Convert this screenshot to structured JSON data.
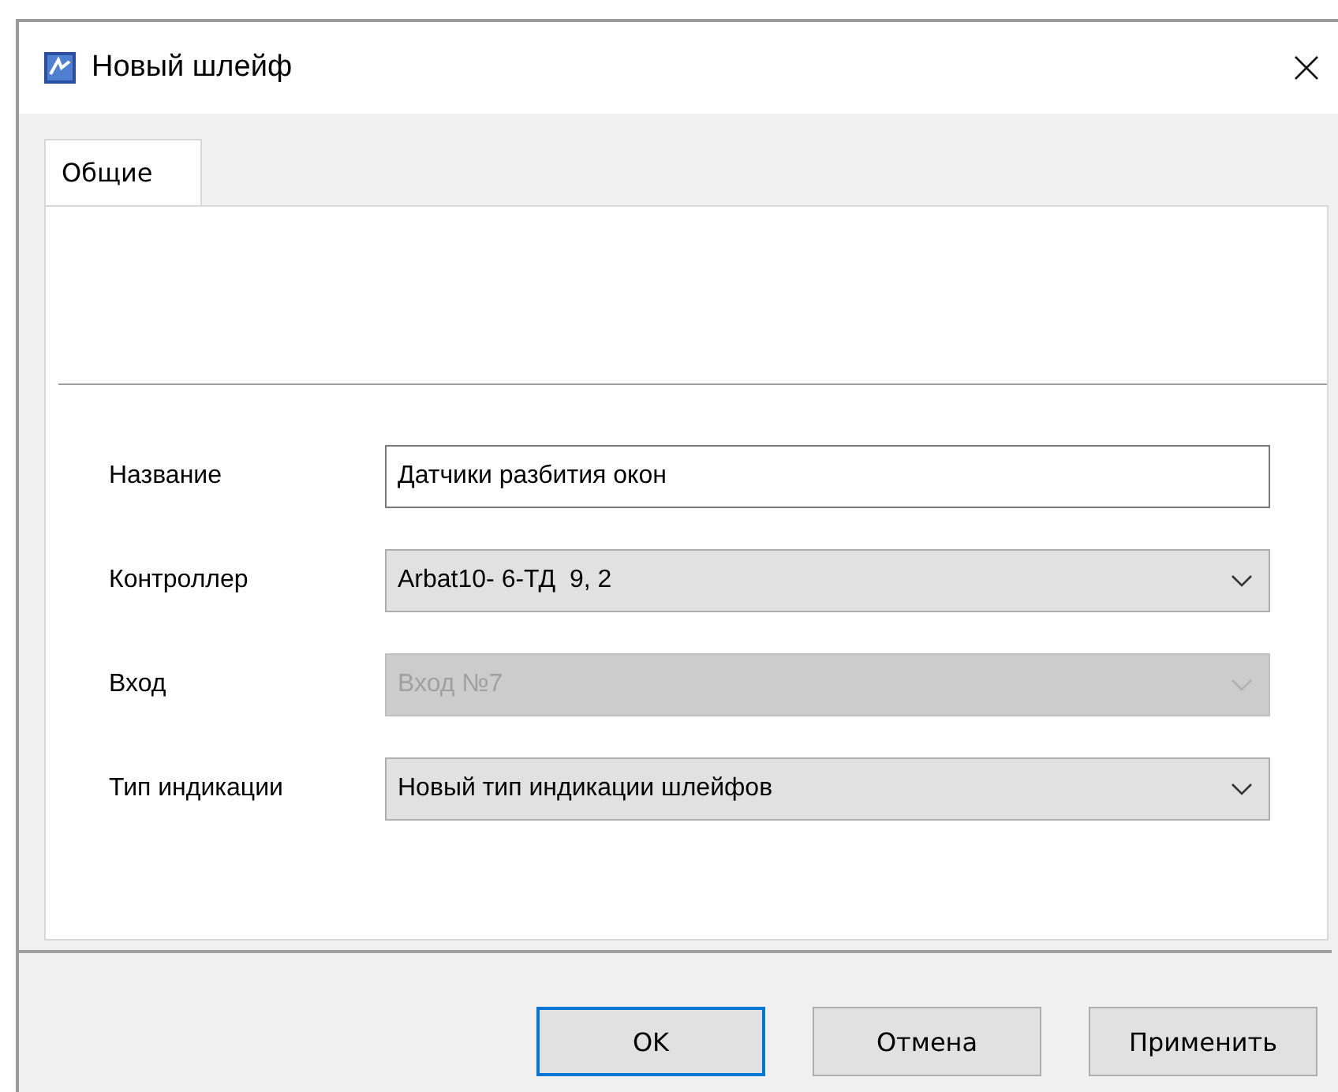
{
  "window": {
    "title": "Новый шлейф"
  },
  "tabs": [
    {
      "label": "Общие",
      "selected": true
    }
  ],
  "fields": [
    {
      "label": "Название",
      "kind": "text",
      "value": "Датчики разбития окон",
      "disabled": false
    },
    {
      "label": "Контроллер",
      "kind": "combo",
      "value": "Arbat10- 6-ТД  9, 2",
      "disabled": false
    },
    {
      "label": "Вход",
      "kind": "combo",
      "value": "Вход №7",
      "disabled": true
    },
    {
      "label": "Тип индикации",
      "kind": "combo",
      "value": "Новый тип индикации шлейфов",
      "disabled": false
    }
  ],
  "buttons": [
    {
      "label": "OK",
      "default": true
    },
    {
      "label": "Отмена",
      "default": false
    },
    {
      "label": "Применить",
      "default": false
    }
  ]
}
